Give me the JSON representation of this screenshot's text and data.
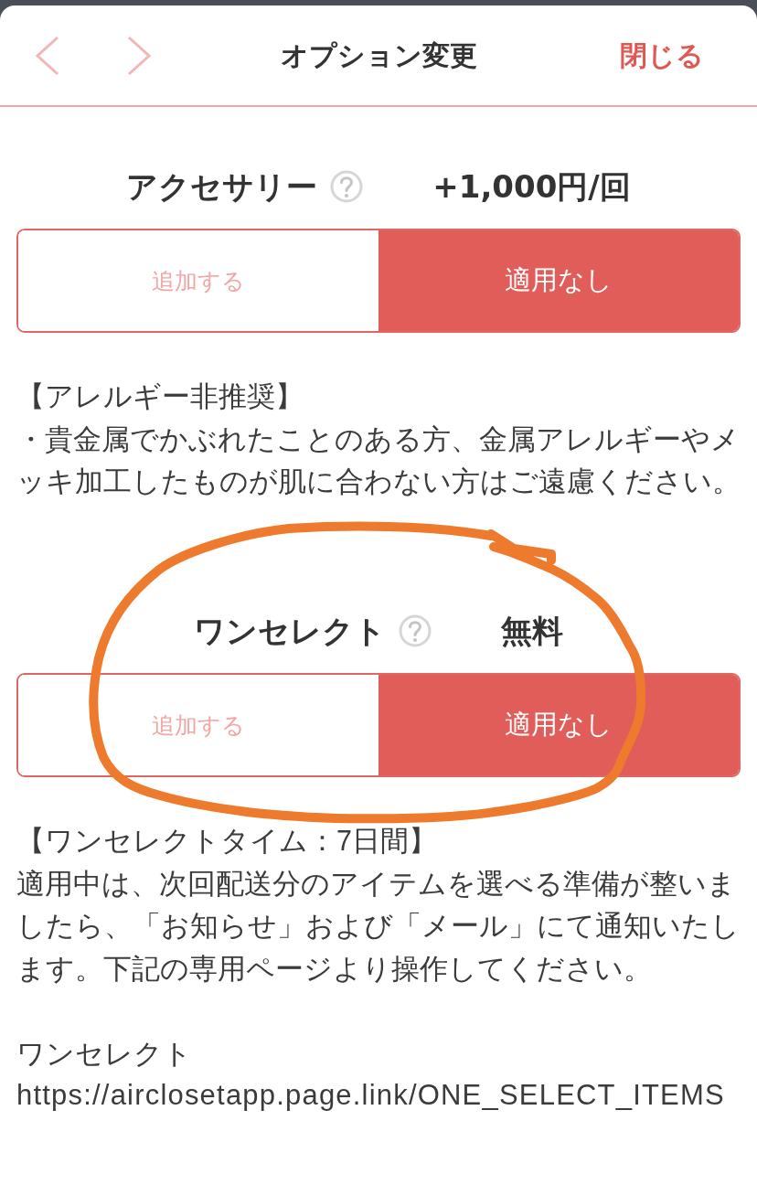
{
  "header": {
    "title": "オプション変更",
    "close_label": "閉じる"
  },
  "sections": [
    {
      "name": "アクセサリー",
      "price": "+1,000円/回",
      "circled": false,
      "options": [
        {
          "label": "追加する",
          "selected": false
        },
        {
          "label": "適用なし",
          "selected": true
        }
      ],
      "notes": [
        [
          {
            "kind": "text",
            "text": "【アレルギー非推奨】"
          },
          {
            "kind": "text",
            "text": "・貴金属でかぶれたことのある方、金属アレルギーやメッキ加工したものが肌に合わない方はご遠慮ください。"
          }
        ]
      ]
    },
    {
      "name": "ワンセレクト",
      "price": "無料",
      "circled": true,
      "options": [
        {
          "label": "追加する",
          "selected": false
        },
        {
          "label": "適用なし",
          "selected": true
        }
      ],
      "notes": [
        [
          {
            "kind": "text",
            "text": "【ワンセレクトタイム：7日間】"
          },
          {
            "kind": "text",
            "text": "適用中は、次回配送分のアイテムを選べる準備が整いましたら、「お知らせ」および「メール」にて通知いたします。下記の専用ページより操作してください。"
          }
        ],
        [
          {
            "kind": "text",
            "text": "ワンセレクト"
          },
          {
            "kind": "url",
            "text": "https://airclosetapp.page.link/ONE_SELECT_ITEMS"
          }
        ]
      ]
    }
  ]
}
